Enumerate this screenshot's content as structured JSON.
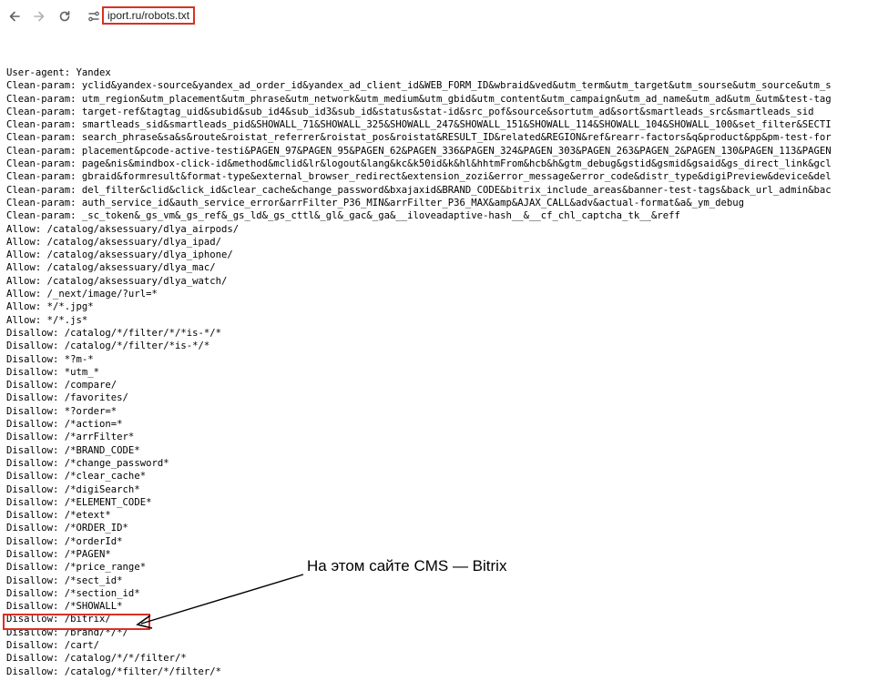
{
  "browser": {
    "url": "iport.ru/robots.txt",
    "icons": [
      "arrow-left-icon",
      "arrow-right-icon",
      "reload-icon",
      "site-settings-icon"
    ]
  },
  "robots_lines": [
    "User-agent: Yandex",
    "Clean-param: yclid&yandex-source&yandex_ad_order_id&yandex_ad_client_id&WEB_FORM_ID&wbraid&ved&utm_term&utm_target&utm_sourse&utm_source&utm_s",
    "Clean-param: utm_region&utm_placement&utm_phrase&utm_network&utm_medium&utm_gbid&utm_content&utm_campaign&utm_ad_name&utm_ad&utm_&utm&test-tag",
    "Clean-param: target-ref&tagtag_uid&subid&sub_id4&sub_id3&sub_id&status&stat-id&src_pof&source&sortutm_ad&sort&smartleads_src&smartleads_sid",
    "Clean-param: smartleads_sid&smartleads_pid&SHOWALL_71&SHOWALL_325&SHOWALL_247&SHOWALL_151&SHOWALL_114&SHOWALL_104&SHOWALL_100&set_filter&SECTI",
    "Clean-param: search_phrase&sa&s&route&roistat_referrer&roistat_pos&roistat&RESULT_ID&related&REGION&ref&rearr-factors&q&product&pp&pm-test-for",
    "Clean-param: placement&pcode-active-testi&PAGEN_97&PAGEN_95&PAGEN_62&PAGEN_336&PAGEN_324&PAGEN_303&PAGEN_263&PAGEN_2&PAGEN_130&PAGEN_113&PAGEN",
    "Clean-param: page&nis&mindbox-click-id&method&mclid&lr&logout&lang&kc&k50id&k&hl&hhtmFrom&hcb&h&gtm_debug&gstid&gsmid&gsaid&gs_direct_link&gcl",
    "Clean-param: gbraid&formresult&format-type&external_browser_redirect&extension_zozi&error_message&error_code&distr_type&digiPreview&device&del",
    "Clean-param: del_filter&clid&click_id&clear_cache&change_password&bxajaxid&BRAND_CODE&bitrix_include_areas&banner-test-tags&back_url_admin&bac",
    "Clean-param: auth_service_id&auth_service_error&arrFilter_P36_MIN&arrFilter_P36_MAX&amp&AJAX_CALL&adv&actual-format&a&_ym_debug",
    "Clean-param: _sc_token&_gs_vm&_gs_ref&_gs_ld&_gs_cttl&_gl&_gac&_ga&__iloveadaptive-hash__&__cf_chl_captcha_tk__&reff",
    "Allow: /catalog/aksessuary/dlya_airpods/",
    "Allow: /catalog/aksessuary/dlya_ipad/",
    "Allow: /catalog/aksessuary/dlya_iphone/",
    "Allow: /catalog/aksessuary/dlya_mac/",
    "Allow: /catalog/aksessuary/dlya_watch/",
    "Allow: /_next/image/?url=*",
    "Allow: */*.jpg*",
    "Allow: */*.js*",
    "Disallow: /catalog/*/filter/*/*is-*/*",
    "Disallow: /catalog/*/filter/*is-*/*",
    "Disallow: *?m-*",
    "Disallow: *utm_*",
    "Disallow: /compare/",
    "Disallow: /favorites/",
    "Disallow: *?order=*",
    "Disallow: /*action=*",
    "Disallow: /*arrFilter*",
    "Disallow: /*BRAND_CODE*",
    "Disallow: /*change_password*",
    "Disallow: /*clear_cache*",
    "Disallow: /*digiSearch*",
    "Disallow: /*ELEMENT_CODE*",
    "Disallow: /*etext*",
    "Disallow: /*ORDER_ID*",
    "Disallow: /*orderId*",
    "Disallow: /*PAGEN*",
    "Disallow: /*price_range*",
    "Disallow: /*sect_id*",
    "Disallow: /*section_id*",
    "Disallow: /*SHOWALL*",
    "Disallow: /bitrix/",
    "Disallow: /brand/*/*/",
    "Disallow: /cart/",
    "Disallow: /catalog/*/*/filter/*",
    "Disallow: /catalog/*filter/*/filter/*"
  ],
  "annotation": {
    "text": "На этом сайте CMS — Bitrix",
    "accent_color": "#d93025"
  }
}
